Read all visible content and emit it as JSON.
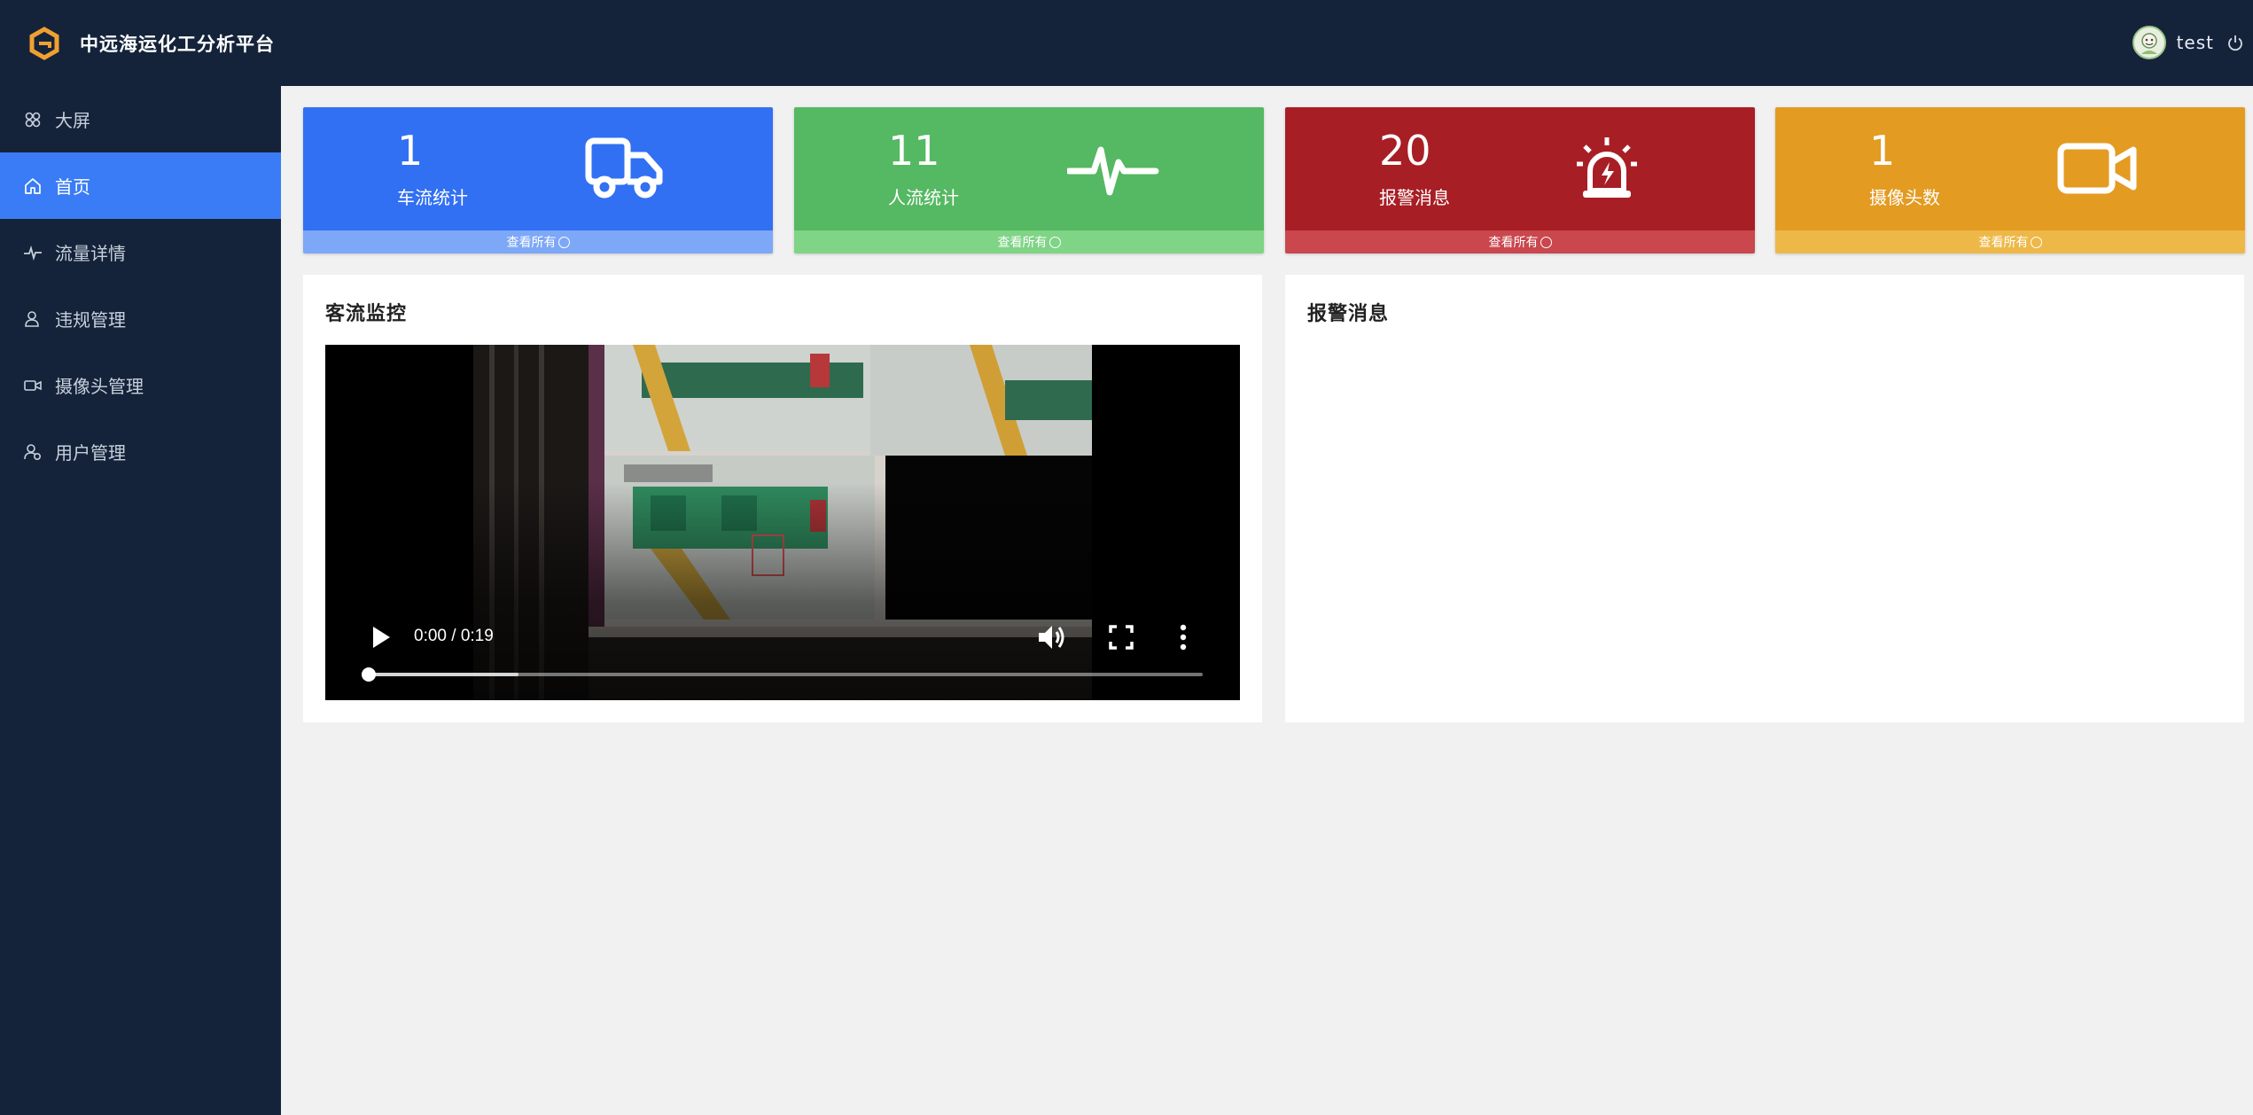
{
  "app": {
    "title": "中远海运化工分析平台",
    "user": "test"
  },
  "colors": {
    "sidebar_bg": "#14233a",
    "active": "#3a7cf5",
    "blue": "#3170f2",
    "green": "#55b862",
    "red": "#a81e25",
    "orange": "#e39b22"
  },
  "sidebar": {
    "items": [
      {
        "label": "大屏",
        "icon": "grid-icon"
      },
      {
        "label": "首页",
        "icon": "home-icon",
        "active": true
      },
      {
        "label": "流量详情",
        "icon": "pulse-icon"
      },
      {
        "label": "违规管理",
        "icon": "user-warning-icon"
      },
      {
        "label": "摄像头管理",
        "icon": "camera-icon"
      },
      {
        "label": "用户管理",
        "icon": "user-settings-icon"
      }
    ]
  },
  "cards": [
    {
      "value": "1",
      "label": "车流统计",
      "footer": "查看所有",
      "icon": "truck-icon"
    },
    {
      "value": "11",
      "label": "人流统计",
      "footer": "查看所有",
      "icon": "heartbeat-icon"
    },
    {
      "value": "20",
      "label": "报警消息",
      "footer": "查看所有",
      "icon": "alarm-icon"
    },
    {
      "value": "1",
      "label": "摄像头数",
      "footer": "查看所有",
      "icon": "video-icon"
    }
  ],
  "panels": {
    "traffic": {
      "title": "客流监控"
    },
    "alerts": {
      "title": "报警消息"
    }
  },
  "video": {
    "time": "0:00 / 0:19",
    "buffered_fraction": 0.18,
    "played_fraction": 0.0
  }
}
